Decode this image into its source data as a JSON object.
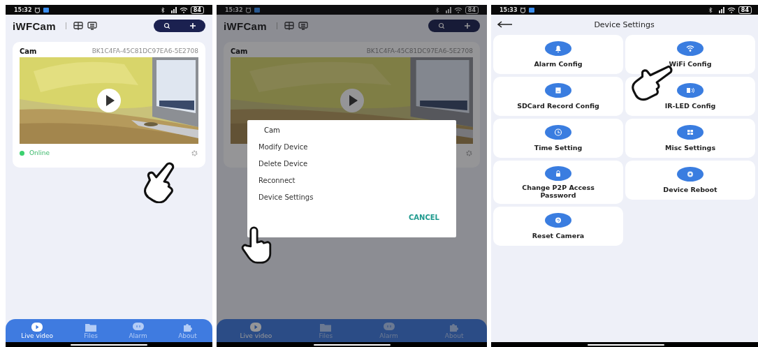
{
  "screens": [
    {
      "kind": "home",
      "dimmed": false,
      "status_bar": {
        "time": "15:32",
        "battery": "84"
      },
      "app_title": "iWFCam",
      "device_card": {
        "name": "Cam",
        "id": "BK1C4FA-45C81DC97EA6-5E2708",
        "status": "Online",
        "online": true
      },
      "nav": [
        {
          "label": "Live video",
          "selected": true
        },
        {
          "label": "Files",
          "selected": false
        },
        {
          "label": "Alarm",
          "selected": false
        },
        {
          "label": "About",
          "selected": false
        }
      ]
    },
    {
      "kind": "home",
      "dimmed": true,
      "status_bar": {
        "time": "15:32",
        "battery": "84"
      },
      "app_title": "iWFCam",
      "device_card": {
        "name": "Cam",
        "id": "BK1C4FA-45C81DC97EA6-5E2708"
      },
      "menu": {
        "title": "Cam",
        "items": [
          "Modify Device",
          "Delete Device",
          "Reconnect",
          "Device Settings"
        ],
        "cancel": "CANCEL"
      },
      "nav": [
        {
          "label": "Live video",
          "selected": true
        },
        {
          "label": "Files",
          "selected": false
        },
        {
          "label": "Alarm",
          "selected": false
        },
        {
          "label": "About",
          "selected": false
        }
      ]
    },
    {
      "kind": "settings",
      "status_bar": {
        "time": "15:33",
        "battery": "84"
      },
      "title": "Device Settings",
      "items": [
        "Alarm Config",
        "WiFi Config",
        "SDCard Record Config",
        "IR-LED Config",
        "Time Setting",
        "Misc Settings",
        "Change P2P Access Password",
        "Device Reboot",
        "Reset Camera"
      ]
    }
  ]
}
